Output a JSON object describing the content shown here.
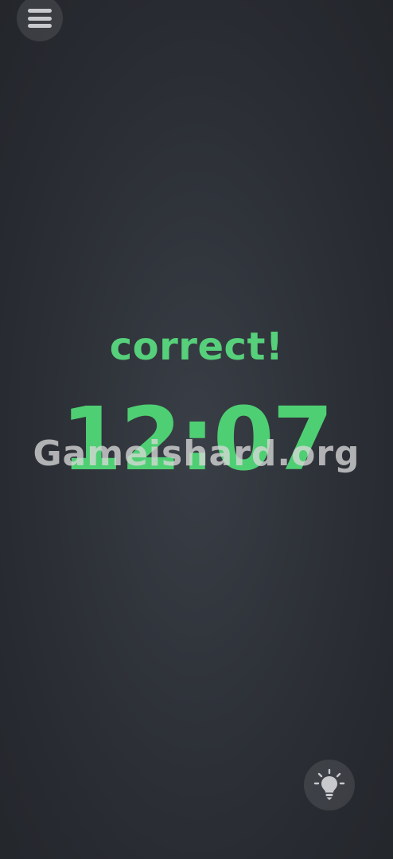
{
  "menu": {
    "icon": "hamburger-menu-icon"
  },
  "result": {
    "message": "correct!",
    "time": "12:07"
  },
  "watermark": {
    "text": "Gameishard.org"
  },
  "hint": {
    "icon": "lightbulb-icon"
  },
  "colors": {
    "accent_green": "#4fcf73",
    "background": "#2b2f35",
    "icon": "#c7c9cd"
  }
}
